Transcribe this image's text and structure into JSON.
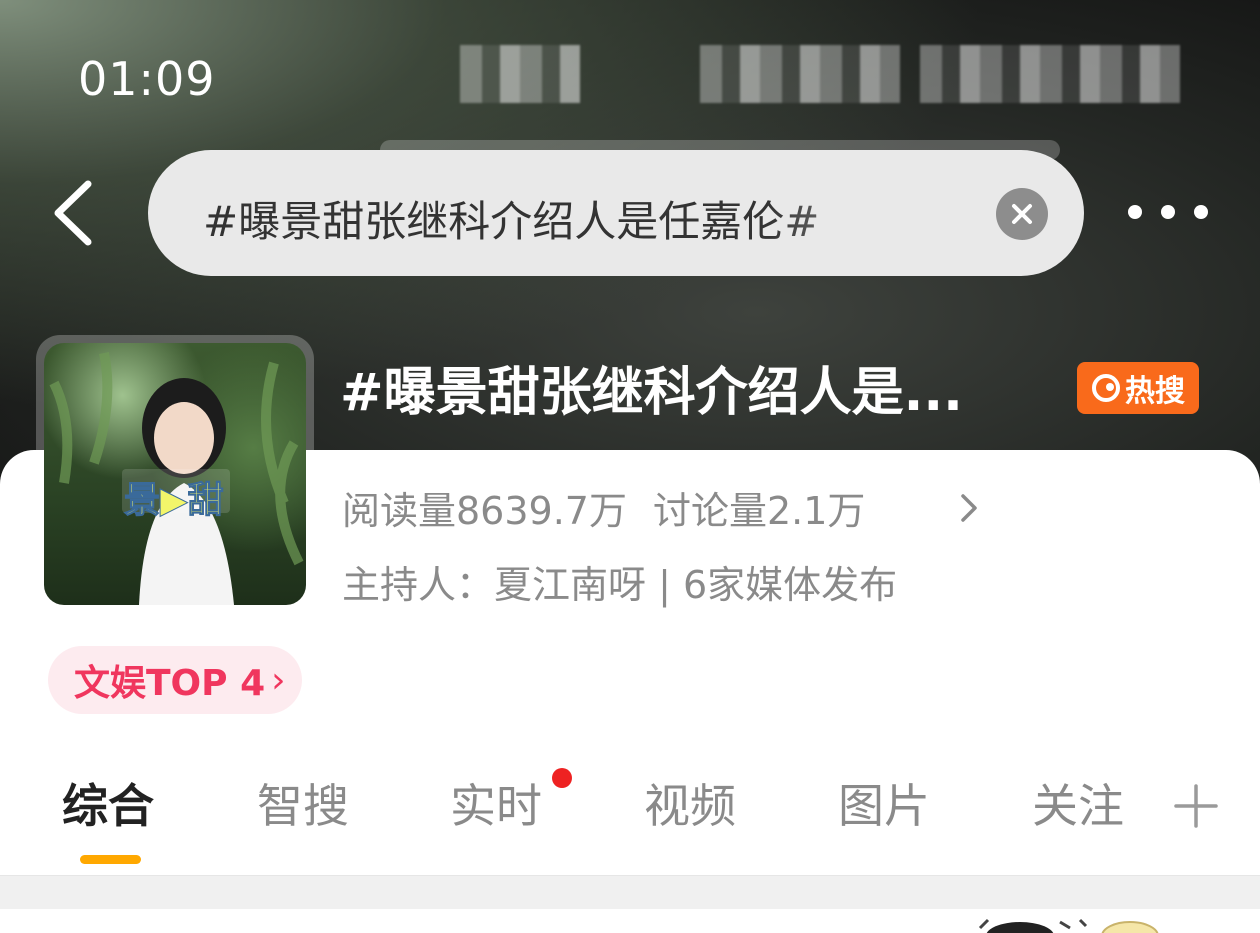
{
  "status_bar": {
    "time": "01:09"
  },
  "search": {
    "query": "#曝景甜张继科介绍人是任嘉伦#"
  },
  "topic": {
    "title": "#曝景甜张继科介绍人是...",
    "hot_badge": "热搜",
    "reads": "阅读量8639.7万",
    "discussions": "讨论量2.1万",
    "host_line": "主持人：夏江南呀 | 6家媒体发布",
    "thumbnail_caption": "景▶甜",
    "rank": "文娱TOP 4",
    "rank_arrow": "›"
  },
  "tabs": [
    {
      "label": "综合",
      "active": true
    },
    {
      "label": "智搜",
      "active": false
    },
    {
      "label": "实时",
      "active": false,
      "has_dot": true
    },
    {
      "label": "视频",
      "active": false
    },
    {
      "label": "图片",
      "active": false
    },
    {
      "label": "关注",
      "active": false
    }
  ],
  "colors": {
    "accent_orange": "#ffa800",
    "hot_badge": "#f96a1b",
    "rank_pink": "#f0365e",
    "notification_dot": "#ee2222"
  },
  "icons": [
    "back-arrow-icon",
    "clear-icon",
    "more-icon",
    "hot-flame-icon",
    "chevron-right-icon",
    "plus-icon"
  ]
}
